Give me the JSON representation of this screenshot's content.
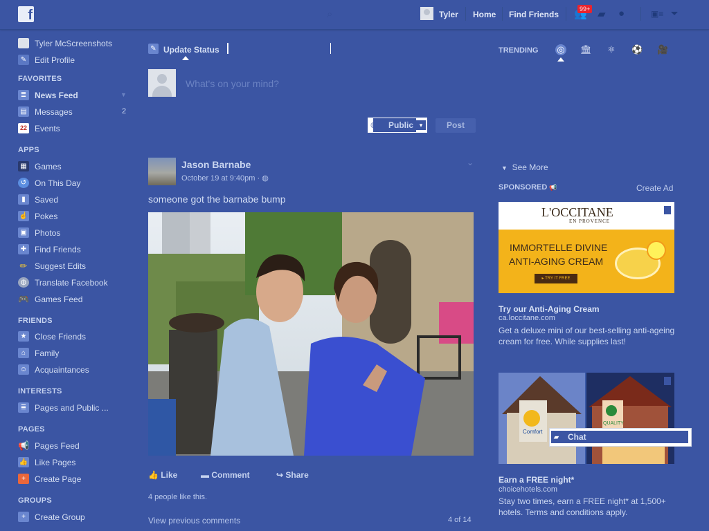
{
  "topbar": {
    "user_name": "Tyler",
    "home": "Home",
    "find_friends": "Find Friends",
    "friend_requests_badge": "99+"
  },
  "sidebar": {
    "profile_name": "Tyler McScreenshots",
    "edit_profile": "Edit Profile",
    "sections": {
      "favorites": "FAVORITES",
      "apps": "APPS",
      "friends": "FRIENDS",
      "interests": "INTERESTS",
      "pages": "PAGES",
      "groups": "GROUPS"
    },
    "favorites": [
      {
        "label": "News Feed",
        "icon": "news-feed-icon"
      },
      {
        "label": "Messages",
        "icon": "messages-icon",
        "count": "2"
      },
      {
        "label": "Events",
        "icon": "events-icon",
        "icon_text": "22"
      }
    ],
    "apps": [
      {
        "label": "Games",
        "icon": "games-icon"
      },
      {
        "label": "On This Day",
        "icon": "on-this-day-icon"
      },
      {
        "label": "Saved",
        "icon": "saved-icon"
      },
      {
        "label": "Pokes",
        "icon": "pokes-icon"
      },
      {
        "label": "Photos",
        "icon": "photos-icon"
      },
      {
        "label": "Find Friends",
        "icon": "find-friends-icon"
      },
      {
        "label": "Suggest Edits",
        "icon": "suggest-edits-icon"
      },
      {
        "label": "Translate Facebook",
        "icon": "translate-icon"
      },
      {
        "label": "Games Feed",
        "icon": "games-feed-icon"
      }
    ],
    "friends": [
      {
        "label": "Close Friends",
        "icon": "close-friends-icon"
      },
      {
        "label": "Family",
        "icon": "family-icon"
      },
      {
        "label": "Acquaintances",
        "icon": "acquaintances-icon"
      }
    ],
    "interests": [
      {
        "label": "Pages and Public ...",
        "icon": "pages-public-icon"
      }
    ],
    "pages": [
      {
        "label": "Pages Feed",
        "icon": "pages-feed-icon"
      },
      {
        "label": "Like Pages",
        "icon": "like-pages-icon"
      },
      {
        "label": "Create Page",
        "icon": "create-page-icon"
      }
    ],
    "groups": [
      {
        "label": "Create Group",
        "icon": "create-group-icon"
      }
    ]
  },
  "composer": {
    "tab_label": "Update Status",
    "placeholder": "What's on your mind?",
    "audience": "Public",
    "post_button": "Post"
  },
  "post": {
    "author": "Jason Barnabe",
    "timestamp": "October 19 at 9:40pm ·",
    "text": "someone got the barnabe bump",
    "actions": {
      "like": "Like",
      "comment": "Comment",
      "share": "Share"
    },
    "likes": "4 people like this.",
    "view_previous": "View previous comments",
    "comment_pager": "4 of 14"
  },
  "right": {
    "trending_label": "TRENDING",
    "see_more": "See More",
    "sponsored_label": "SPONSORED",
    "create_ad": "Create Ad",
    "ads": [
      {
        "image_brand": "L'OCCITANE",
        "image_brand_sub": "EN PROVENCE",
        "image_headline_1": "IMMORTELLE DIVINE",
        "image_headline_2": "ANTI-AGING CREAM",
        "image_cta": "▸ TRY IT FREE",
        "title": "Try our Anti-Aging Cream",
        "domain": "ca.loccitane.com",
        "desc": "Get a deluxe mini of our best-selling anti-ageing cream for free. While supplies last!"
      },
      {
        "image_sign_1": "Comfort",
        "image_sign_2": "QUALITY",
        "title": "Earn a FREE night*",
        "domain": "choicehotels.com",
        "desc": "Stay two times, earn a FREE night* at 1,500+ hotels. Terms and conditions apply."
      }
    ],
    "chat_label": "Chat"
  },
  "colors": {
    "background": "#3b55a3",
    "ad_yellow": "#f3b31a",
    "badge_red": "#e9242e"
  }
}
